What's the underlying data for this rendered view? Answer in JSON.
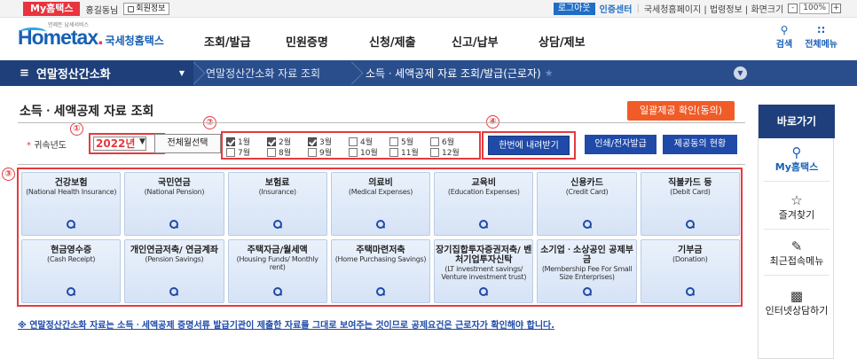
{
  "util": {
    "myhome": "My홈택스",
    "user": "홍길동님",
    "member_info": "회원정보",
    "login": "로그아웃",
    "cert_center": "인증센터",
    "links": "국세청홈페이지 | 법령정보 | 화면크기",
    "zoom_minus": "-",
    "zoom_value": "100%",
    "zoom_plus": "+"
  },
  "header": {
    "logo_sub": "언제든 납세서비스",
    "logo_main": "Hometax",
    "logo_kr": "국세청홈택스",
    "gnb": [
      "조회/발급",
      "민원증명",
      "신청/제출",
      "신고/납부",
      "상담/제보"
    ],
    "search_label": "검색",
    "allmenu_label": "전체메뉴"
  },
  "breadcrumb": {
    "home": "연말정산간소화",
    "level1": "연말정산간소화 자료 조회",
    "level2": "소득ㆍ세액공제 자료 조회/발급(근로자)"
  },
  "page": {
    "title": "소득ㆍ세액공제 자료 조회",
    "consent_btn": "일괄제공 확인(동의)"
  },
  "filter": {
    "year_label": "귀속년도",
    "year_value": "2022년",
    "all_months_btn": "전체월선택",
    "months": [
      {
        "label": "1월",
        "checked": true
      },
      {
        "label": "2월",
        "checked": true
      },
      {
        "label": "3월",
        "checked": true
      },
      {
        "label": "4월",
        "checked": false
      },
      {
        "label": "5월",
        "checked": false
      },
      {
        "label": "6월",
        "checked": false
      },
      {
        "label": "7월",
        "checked": false
      },
      {
        "label": "8월",
        "checked": false
      },
      {
        "label": "9월",
        "checked": false
      },
      {
        "label": "10월",
        "checked": false
      },
      {
        "label": "11월",
        "checked": false
      },
      {
        "label": "12월",
        "checked": false
      }
    ],
    "download_btn": "한번에 내려받기",
    "print_btn": "인쇄/전자발급",
    "provider_btn": "제공동의 현황"
  },
  "markers": [
    "①",
    "②",
    "③",
    "④"
  ],
  "categories": [
    {
      "name": "건강보험",
      "en": "(National Health Insurance)"
    },
    {
      "name": "국민연금",
      "en": "(National Pension)"
    },
    {
      "name": "보험료",
      "en": "(Insurance)"
    },
    {
      "name": "의료비",
      "en": "(Medical Expenses)"
    },
    {
      "name": "교육비",
      "en": "(Education Expenses)"
    },
    {
      "name": "신용카드",
      "en": "(Credit Card)"
    },
    {
      "name": "직불카드 등",
      "en": "(Debit Card)"
    },
    {
      "name": "현금영수증",
      "en": "(Cash Receipt)"
    },
    {
      "name": "개인연금저축/ 연금계좌",
      "en": "(Pension Savings)"
    },
    {
      "name": "주택자금/월세액",
      "en": "(Housing Funds/ Monthly rent)"
    },
    {
      "name": "주택마련저축",
      "en": "(Home Purchasing Savings)"
    },
    {
      "name": "장기집합투자증권저축/ 벤처기업투자신탁",
      "en": "(LT investment savings/ Venture investment trust)"
    },
    {
      "name": "소기업ㆍ소상공인 공제부금",
      "en": "(Membership Fee For Small Size Enterprises)"
    },
    {
      "name": "기부금",
      "en": "(Donation)"
    }
  ],
  "notice": "※ 연말정산간소화 자료는 소득ㆍ세액공제 증명서류 발급기관이 제출한 자료를 그대로 보여주는 것이므로 공제요건은 근로자가 확인해야 합니다.",
  "quick": {
    "head": "바로가기",
    "items": [
      "My홈택스",
      "즐겨찾기",
      "최근접속메뉴",
      "인터넷상담하기"
    ]
  }
}
